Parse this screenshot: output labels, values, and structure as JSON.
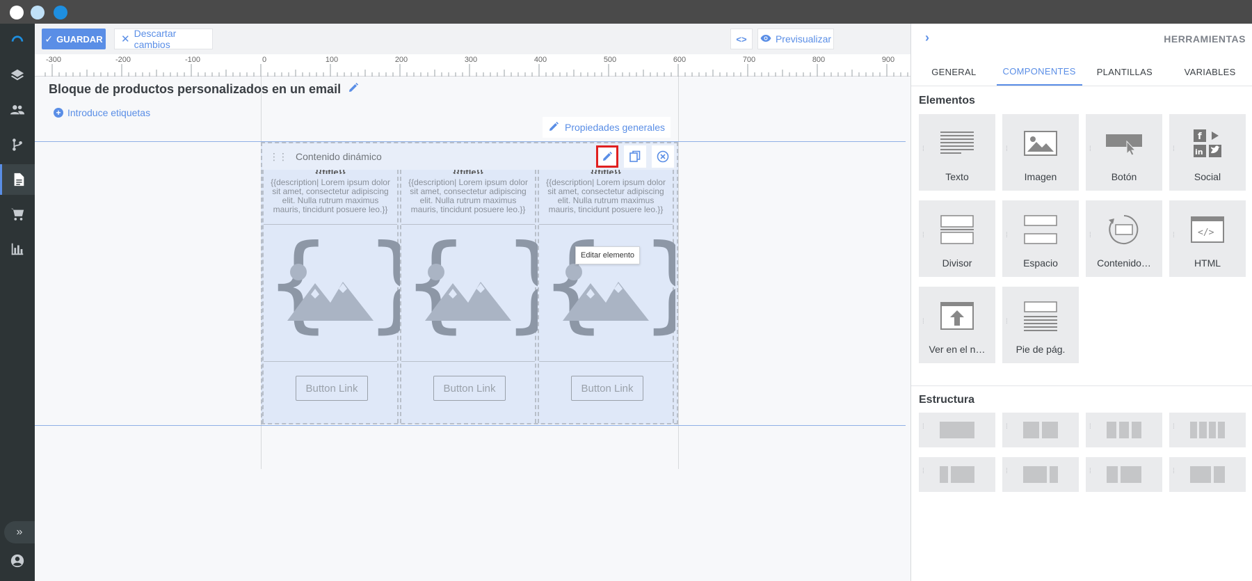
{
  "toolbar": {
    "save_label": "GUARDAR",
    "discard_label": "Descartar cambios",
    "preview_label": "Previsualizar"
  },
  "ruler": {
    "labels": [
      "-300",
      "-200",
      "-100",
      "0",
      "100",
      "200",
      "300",
      "400",
      "500",
      "600",
      "700",
      "800",
      "900"
    ]
  },
  "document": {
    "title": "Bloque de productos personalizados en un email",
    "tags_link": "Introduce etiquetas",
    "properties_button": "Propiedades generales"
  },
  "block": {
    "title": "Contenido dinámico",
    "tooltip": "Editar elemento",
    "columns": [
      {
        "title": "{{title}}",
        "description": "{{description| Lorem ipsum dolor sit amet, consectetur adipiscing elit. Nulla rutrum maximus mauris, tincidunt posuere leo.}}",
        "button": "Button Link"
      },
      {
        "title": "{{title}}",
        "description": "{{description| Lorem ipsum dolor sit amet, consectetur adipiscing elit. Nulla rutrum maximus mauris, tincidunt posuere leo.}}",
        "button": "Button Link"
      },
      {
        "title": "{{title}}",
        "description": "{{description| Lorem ipsum dolor sit amet, consectetur adipiscing elit. Nulla rutrum maximus mauris, tincidunt posuere leo.}}",
        "button": "Button Link"
      }
    ]
  },
  "panel": {
    "title": "HERRAMIENTAS",
    "tabs": [
      "GENERAL",
      "COMPONENTES",
      "PLANTILLAS",
      "VARIABLES"
    ],
    "active_tab": "COMPONENTES",
    "elements_title": "Elementos",
    "elements": [
      "Texto",
      "Imagen",
      "Botón",
      "Social",
      "Divisor",
      "Espacio",
      "Contenido…",
      "HTML",
      "Ver en el n…",
      "Pie de pág."
    ],
    "structure_title": "Estructura"
  },
  "colors": {
    "accent": "#5a8ee6",
    "sidebar": "#2d3436",
    "highlight": "#e02020"
  }
}
